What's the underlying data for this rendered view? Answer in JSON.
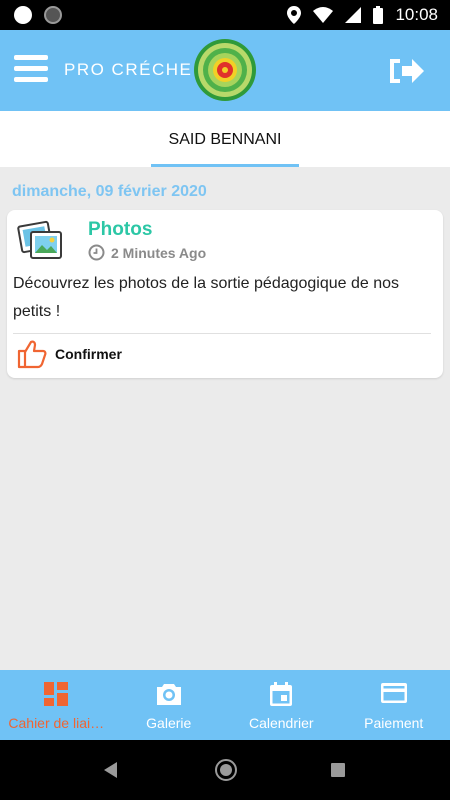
{
  "status_bar": {
    "time": "10:08"
  },
  "header": {
    "brand": "PRO CRÉCHE",
    "menu_icon": "hamburger-menu-icon",
    "logout_icon": "logout-arrow-icon",
    "color": "#70c2f5"
  },
  "tab": {
    "label": "SAID BENNANI"
  },
  "feed": {
    "date": "dimanche, 09 février 2020",
    "items": [
      {
        "icon": "photos-icon",
        "title": "Photos",
        "time": "2 Minutes Ago",
        "body": "Découvrez les photos de la sortie pédagogique de nos petits !",
        "action": "Confirmer"
      }
    ]
  },
  "bottom_nav": {
    "items": [
      {
        "label": "Cahier de liai…",
        "icon": "dashboard-icon",
        "active": true
      },
      {
        "label": "Galerie",
        "icon": "camera-icon",
        "active": false
      },
      {
        "label": "Calendrier",
        "icon": "calendar-icon",
        "active": false
      },
      {
        "label": "Paiement",
        "icon": "credit-card-icon",
        "active": false
      }
    ],
    "active_color": "#f06532"
  }
}
